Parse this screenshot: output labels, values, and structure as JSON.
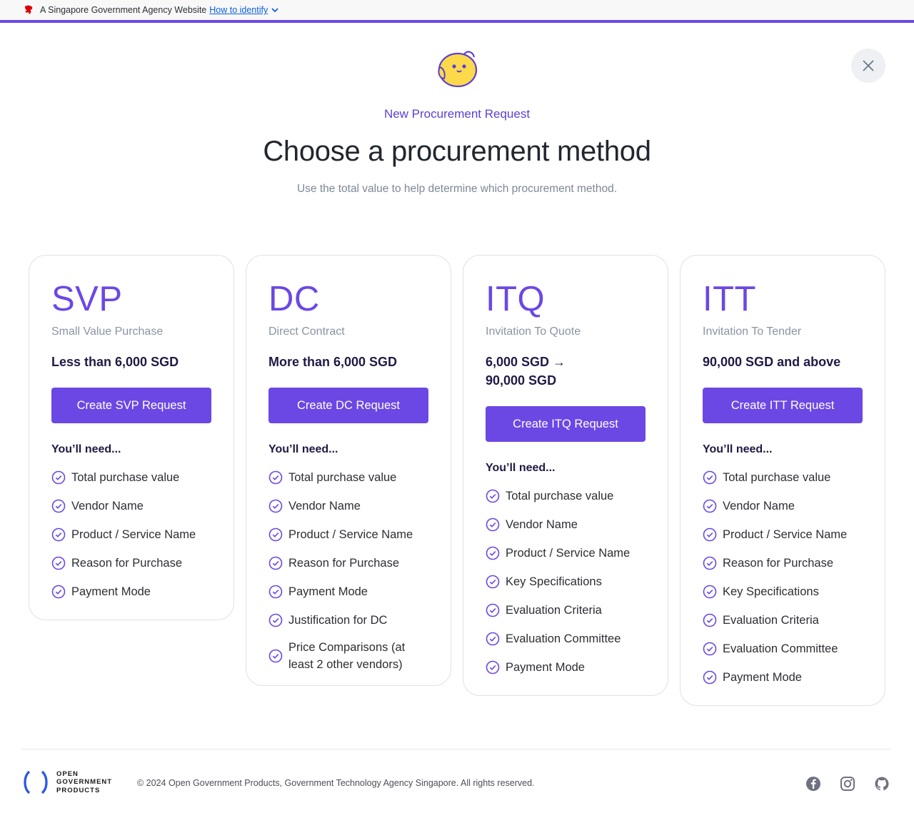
{
  "masthead": {
    "text": "A Singapore Government Agency Website",
    "link": "How to identify"
  },
  "header": {
    "eyebrow": "New Procurement Request",
    "title": "Choose a procurement method",
    "subtitle": "Use the total value to help determine which procurement method."
  },
  "colors": {
    "accent": "#6b48e4",
    "heading": "#1f1a44",
    "muted": "#8a94a4"
  },
  "cards": [
    {
      "abbr": "SVP",
      "name": "Small Value Purchase",
      "range_line1": "Less than 6,000 SGD",
      "range_line2": "",
      "button": "Create SVP Request",
      "need": "You’ll need...",
      "items": [
        "Total purchase value",
        "Vendor Name",
        "Product / Service Name",
        "Reason for Purchase",
        "Payment Mode"
      ]
    },
    {
      "abbr": "DC",
      "name": "Direct Contract",
      "range_line1": "More than 6,000 SGD",
      "range_line2": "",
      "button": "Create DC Request",
      "need": "You’ll need...",
      "items": [
        "Total purchase value",
        "Vendor Name",
        "Product / Service Name",
        "Reason for Purchase",
        "Payment Mode",
        "Justification for DC",
        "Price Comparisons (at least 2 other vendors)"
      ]
    },
    {
      "abbr": "ITQ",
      "name": "Invitation To Quote",
      "range_line1": "6,000 SGD →",
      "range_line2": "90,000 SGD",
      "button": "Create ITQ Request",
      "need": "You’ll need...",
      "items": [
        "Total purchase value",
        "Vendor Name",
        "Product / Service Name",
        "Key Specifications",
        "Evaluation Criteria",
        "Evaluation Committee",
        "Payment Mode"
      ]
    },
    {
      "abbr": "ITT",
      "name": "Invitation To Tender",
      "range_line1": "90,000 SGD and above",
      "range_line2": "",
      "button": "Create ITT Request",
      "need": "You’ll need...",
      "items": [
        "Total purchase value",
        "Vendor Name",
        "Product / Service Name",
        "Reason for Purchase",
        "Key Specifications",
        "Evaluation Criteria",
        "Evaluation Committee",
        "Payment Mode"
      ]
    }
  ],
  "footer": {
    "logo_lines": [
      "OPEN",
      "GOVERNMENT",
      "PRODUCTS"
    ],
    "copyright": "© 2024 Open Government Products, Government Technology Agency Singapore. All rights reserved.",
    "social_icons": [
      "facebook-icon",
      "instagram-icon",
      "github-icon"
    ]
  }
}
